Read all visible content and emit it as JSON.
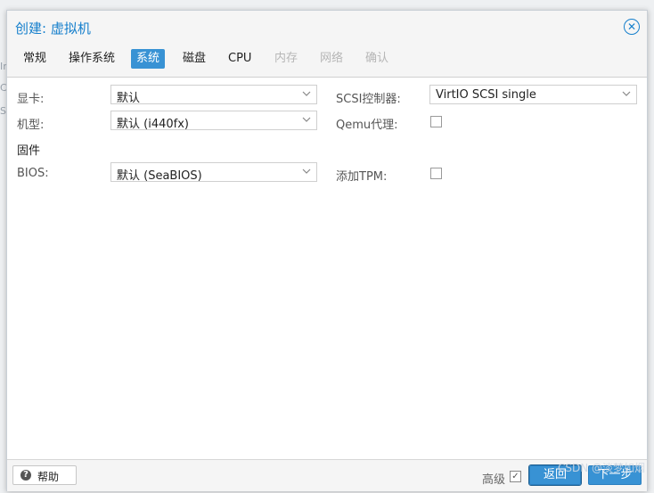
{
  "dialog": {
    "title": "创建: 虚拟机"
  },
  "tabs": [
    {
      "label": "常规",
      "state": "normal"
    },
    {
      "label": "操作系统",
      "state": "normal"
    },
    {
      "label": "系统",
      "state": "active"
    },
    {
      "label": "磁盘",
      "state": "normal"
    },
    {
      "label": "CPU",
      "state": "normal"
    },
    {
      "label": "内存",
      "state": "disabled"
    },
    {
      "label": "网络",
      "state": "disabled"
    },
    {
      "label": "确认",
      "state": "disabled"
    }
  ],
  "form": {
    "graphics": {
      "label": "显卡:",
      "value": "默认"
    },
    "machine": {
      "label": "机型:",
      "value": "默认 (i440fx)"
    },
    "firmware_section": "固件",
    "bios": {
      "label": "BIOS:",
      "value": "默认 (SeaBIOS)"
    },
    "scsi": {
      "label": "SCSI控制器:",
      "value": "VirtIO SCSI single"
    },
    "qemu_agent": {
      "label": "Qemu代理:",
      "checked": false
    },
    "add_tpm": {
      "label": "添加TPM:",
      "checked": false
    }
  },
  "footer": {
    "help_label": "帮助",
    "advanced_label": "高级",
    "advanced_checked": true,
    "back_label": "返回",
    "next_label": "下一步",
    "watermark": "CSDN @淡梦如烟"
  },
  "colors": {
    "accent": "#157fcc",
    "active_tab": "#3892d4"
  }
}
